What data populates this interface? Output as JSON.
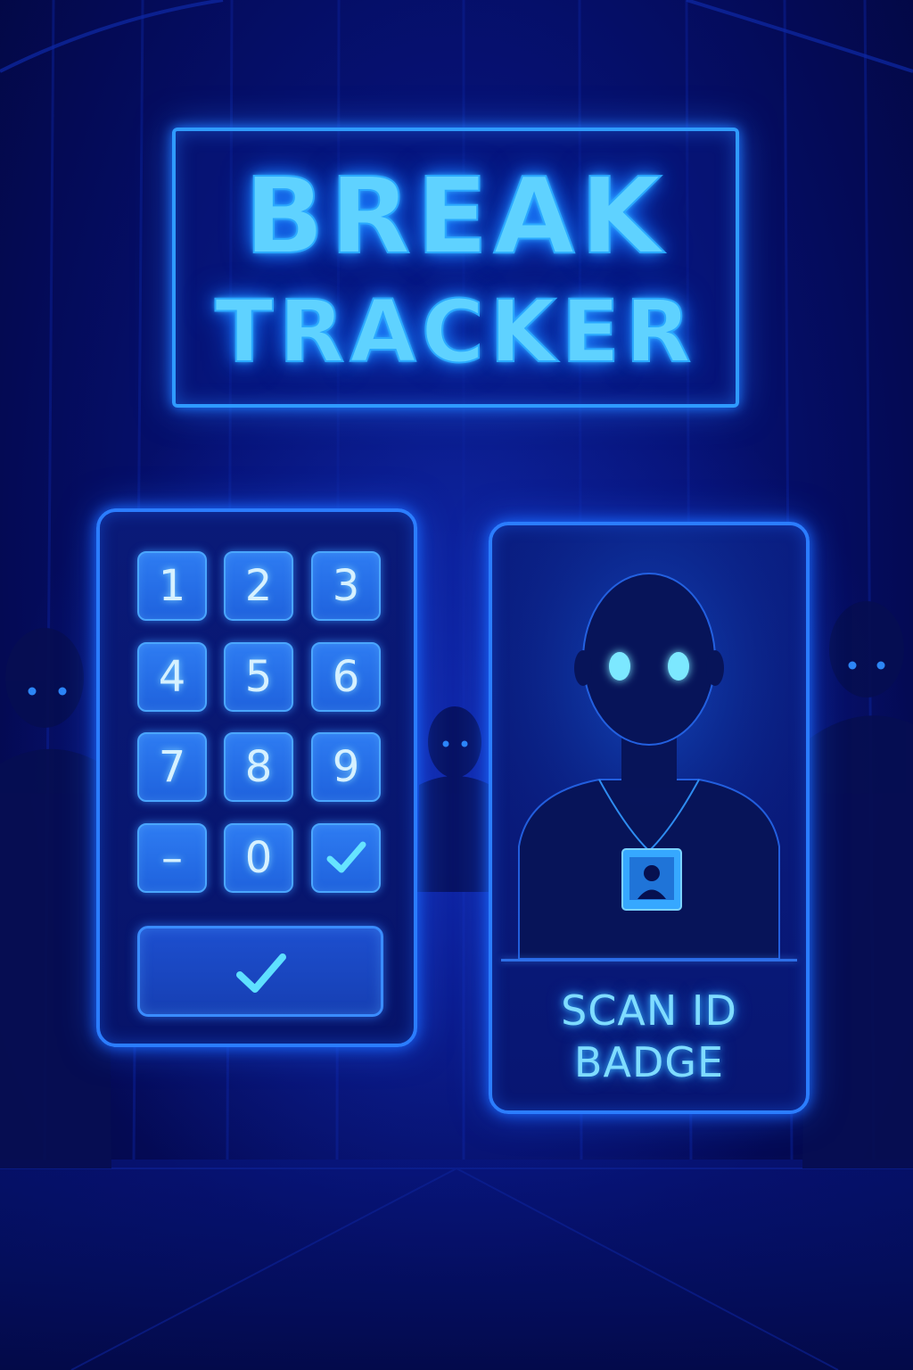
{
  "title": {
    "line1": "BREAK",
    "line2": "TRACKER"
  },
  "keypad": {
    "keys": [
      "1",
      "2",
      "3",
      "4",
      "5",
      "6",
      "7",
      "8",
      "9",
      "–",
      "0"
    ],
    "check_key_icon": "checkmark-icon",
    "confirm_icon": "checkmark-icon"
  },
  "badge_scanner": {
    "label_line1": "SCAN ID",
    "label_line2": "BADGE",
    "figure_icon": "person-silhouette-icon",
    "badge_icon": "id-badge-icon"
  },
  "colors": {
    "background": "#061276",
    "neon_accent": "#2f9bff",
    "text_glow": "#5fd2ff"
  }
}
